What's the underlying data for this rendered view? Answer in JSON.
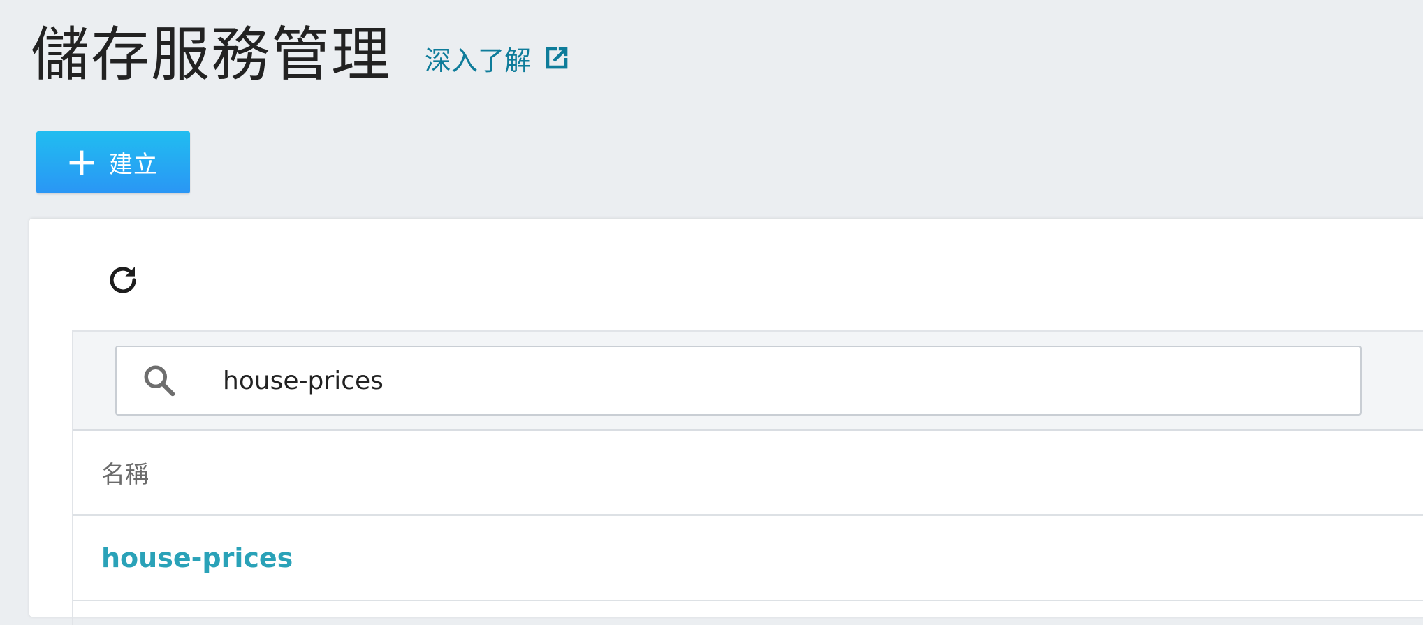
{
  "header": {
    "title": "儲存服務管理",
    "learn_more_label": "深入了解"
  },
  "toolbar": {
    "create_label": "建立"
  },
  "colors": {
    "background": "#ebeef1",
    "link": "#0e7c9a",
    "primary_button_top": "#21bdf0",
    "primary_button_bottom": "#2a96f5",
    "row_link": "#2aa2b8"
  },
  "search": {
    "value": "house-prices",
    "placeholder": ""
  },
  "table": {
    "columns": [
      "名稱"
    ],
    "rows": [
      {
        "name": "house-prices"
      }
    ]
  },
  "icons": {
    "external_link": "external-link-icon",
    "create": "plus-icon",
    "refresh": "refresh-icon",
    "search": "search-icon"
  }
}
